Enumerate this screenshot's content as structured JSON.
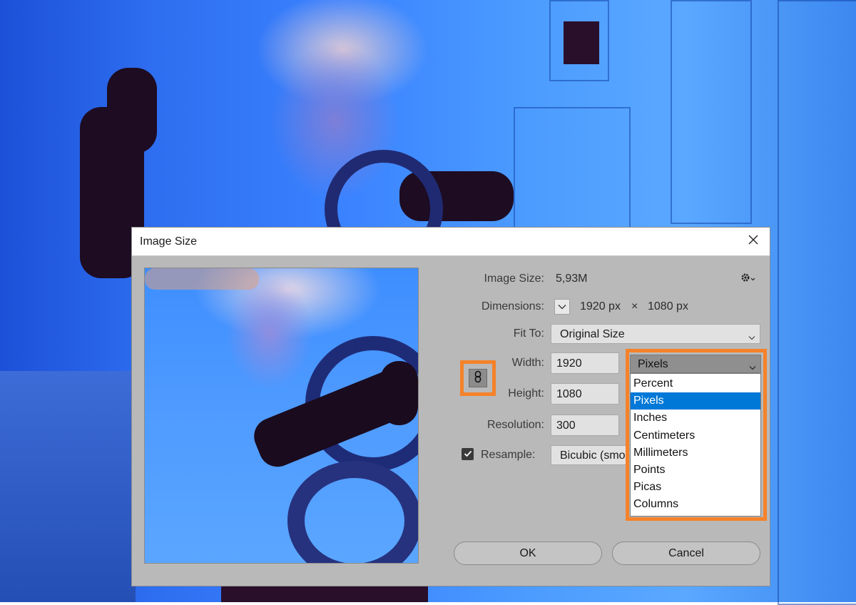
{
  "dialog": {
    "title": "Image Size",
    "close_icon": "close-icon",
    "image_size_label": "Image Size:",
    "image_size_value": "5,93M",
    "settings_icon": "gear-icon",
    "dimensions_label": "Dimensions:",
    "dimensions_width": "1920 px",
    "dimensions_times": "×",
    "dimensions_height": "1080 px",
    "fit_to_label": "Fit To:",
    "fit_to_value": "Original Size",
    "width_label": "Width:",
    "width_value": "1920",
    "height_label": "Height:",
    "height_value": "1080",
    "resolution_label": "Resolution:",
    "resolution_value": "300",
    "resample_label": "Resample:",
    "resample_checked": true,
    "resample_value": "Bicubic (smo",
    "constrain_icon": "link-icon",
    "ok_label": "OK",
    "cancel_label": "Cancel"
  },
  "unit_dropdown": {
    "selected": "Pixels",
    "options": [
      "Percent",
      "Pixels",
      "Inches",
      "Centimeters",
      "Millimeters",
      "Points",
      "Picas",
      "Columns"
    ],
    "highlighted_index": 1
  },
  "colors": {
    "highlight_outline": "#f5822a",
    "selection": "#0078d7"
  }
}
